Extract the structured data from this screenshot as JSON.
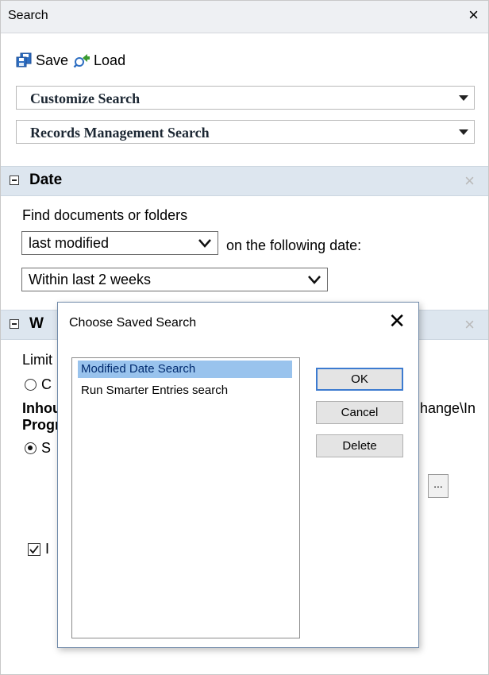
{
  "panel": {
    "title": "Search",
    "close_glyph": "×"
  },
  "toolbar": {
    "save_label": "Save",
    "load_label": "Load",
    "save_icon": "save-icon",
    "load_icon": "load-icon"
  },
  "dropdowns": {
    "customize": "Customize Search",
    "records": "Records Management Search"
  },
  "date_section": {
    "title": "Date",
    "close_glyph": "×",
    "find_label": "Find documents or folders",
    "modified_value": "last modified",
    "following_label": "on the following date:",
    "range_value": "Within last 2 weeks"
  },
  "w_section": {
    "title_fragment": "W",
    "close_glyph": "×",
    "limit_fragment": "Limit",
    "option1_fragment": "C",
    "inhou_fragment": "Inhou",
    "change_fragment": "hange\\In",
    "progr_fragment": "Progr",
    "option2_fragment": "S",
    "include_fragment": "I",
    "ellipsis": "..."
  },
  "dialog": {
    "title": "Choose Saved Search",
    "close_glyph": "✕",
    "items": [
      "Modified Date Search",
      "Run Smarter Entries search"
    ],
    "selected_index": 0,
    "ok_label": "OK",
    "cancel_label": "Cancel",
    "delete_label": "Delete"
  }
}
